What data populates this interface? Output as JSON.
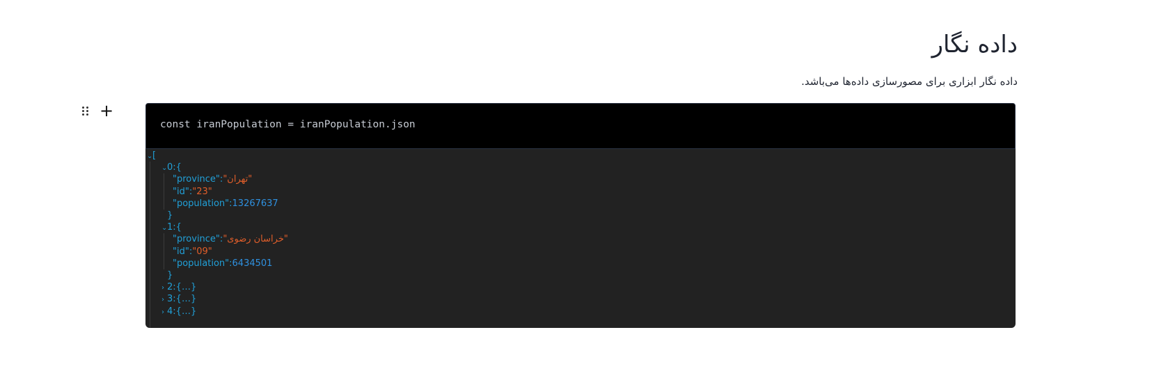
{
  "header": {
    "title": "داده نگار",
    "subtitle": "داده نگار ابزاری برای مصورسازی داده‌ها می‌باشد."
  },
  "cell": {
    "code": "const iranPopulation = iranPopulation.json"
  },
  "output": {
    "open_bracket": "[",
    "items": [
      {
        "index": "0",
        "expanded": true,
        "open": "{",
        "close": "}",
        "fields": [
          {
            "key": "\"province\"",
            "value": "\"تهران\"",
            "kind": "string"
          },
          {
            "key": "\"id\"",
            "value": "\"23\"",
            "kind": "string"
          },
          {
            "key": "\"population\"",
            "value": "13267637",
            "kind": "number"
          }
        ]
      },
      {
        "index": "1",
        "expanded": true,
        "open": "{",
        "close": "}",
        "fields": [
          {
            "key": "\"province\"",
            "value": "\"خراسان رضوی\"",
            "kind": "string"
          },
          {
            "key": "\"id\"",
            "value": "\"09\"",
            "kind": "string"
          },
          {
            "key": "\"population\"",
            "value": "6434501",
            "kind": "number"
          }
        ]
      },
      {
        "index": "2",
        "expanded": false,
        "summary": "{…}"
      },
      {
        "index": "3",
        "expanded": false,
        "summary": "{…}"
      },
      {
        "index": "4",
        "expanded": false,
        "summary": "{…}"
      }
    ]
  },
  "icons": {
    "drag": "drag-handle-icon",
    "add": "plus-icon",
    "expand": "chevron-down-icon",
    "collapse": "chevron-right-icon"
  },
  "colors": {
    "key": "#21a0d8",
    "string": "#e05e2a",
    "number": "#2f91e0",
    "code_bg": "#000000",
    "output_bg": "#222222"
  }
}
